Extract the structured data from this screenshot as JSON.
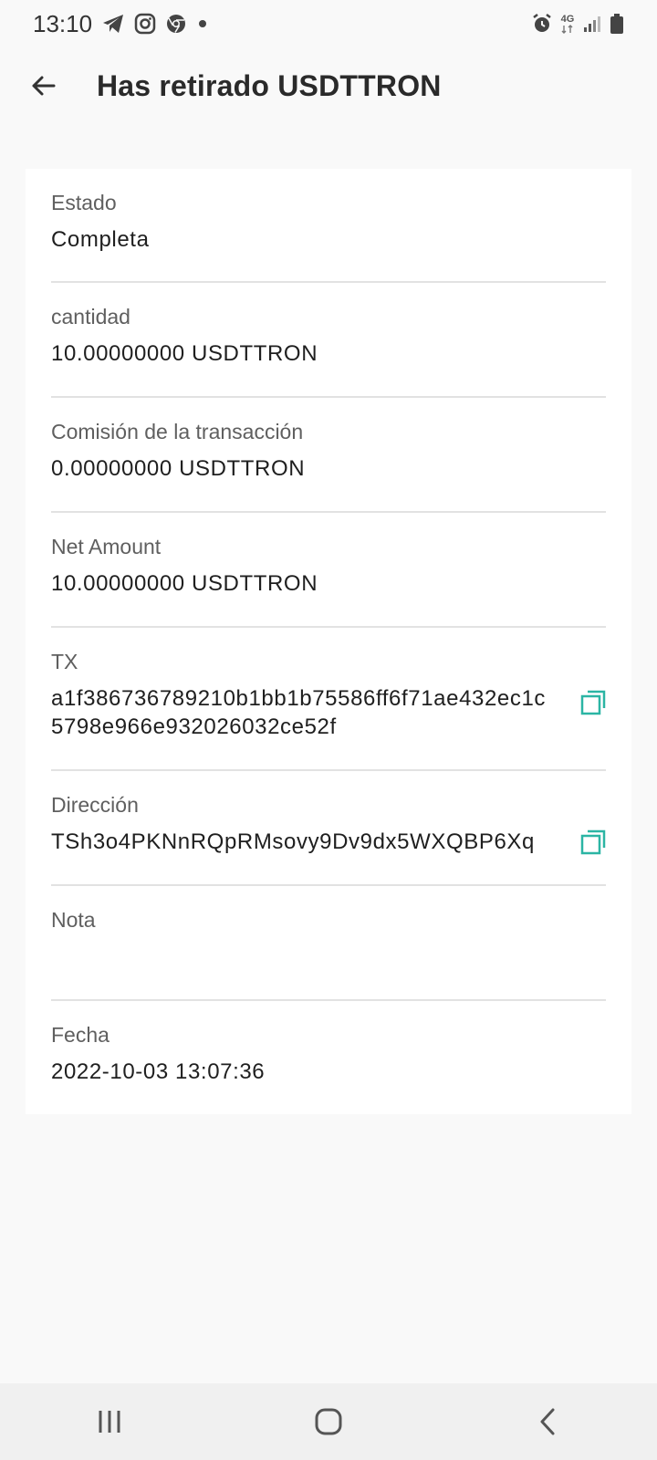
{
  "status_bar": {
    "time": "13:10",
    "notification_icons": [
      "telegram-icon",
      "instagram-icon",
      "chrome-icon",
      "dot-icon"
    ],
    "network": "4G"
  },
  "header": {
    "title": "Has retirado USDTTRON"
  },
  "details": {
    "estado": {
      "label": "Estado",
      "value": "Completa"
    },
    "cantidad": {
      "label": "cantidad",
      "value": "10.00000000 USDTTRON"
    },
    "comision": {
      "label": "Comisión de la transacción",
      "value": "0.00000000 USDTTRON"
    },
    "net_amount": {
      "label": "Net Amount",
      "value": "10.00000000 USDTTRON"
    },
    "tx": {
      "label": "TX",
      "value": "a1f386736789210b1bb1b75586ff6f71ae432ec1c5798e966e932026032ce52f"
    },
    "direccion": {
      "label": "Dirección",
      "value": "TSh3o4PKNnRQpRMsovy9Dv9dx5WXQBP6Xq"
    },
    "nota": {
      "label": "Nota",
      "value": ""
    },
    "fecha": {
      "label": "Fecha",
      "value": "2022-10-03 13:07:36"
    }
  },
  "colors": {
    "accent": "#2bb5a4",
    "background": "#f9f9f9",
    "card": "#ffffff",
    "divider": "#e2e2e2"
  }
}
